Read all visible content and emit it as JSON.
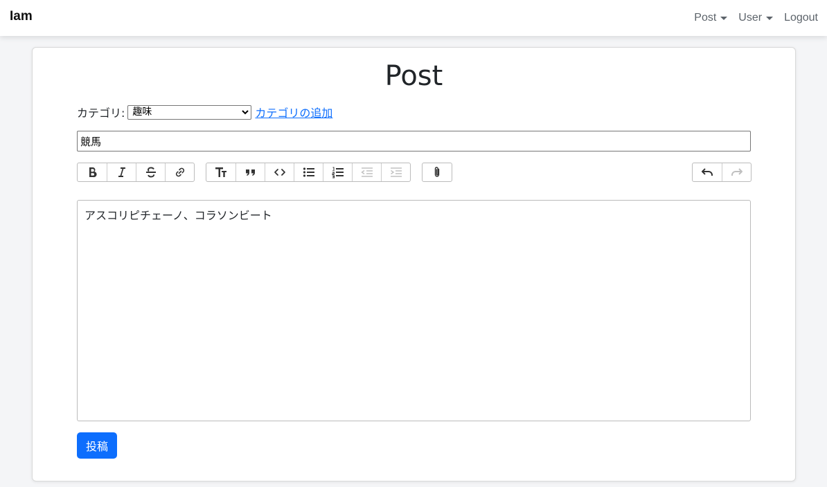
{
  "navbar": {
    "brand": "Iam",
    "items": [
      {
        "label": "Post",
        "dropdown": true
      },
      {
        "label": "User",
        "dropdown": true
      },
      {
        "label": "Logout",
        "dropdown": false
      }
    ]
  },
  "form": {
    "title": "Post",
    "category_label": "カテゴリ:",
    "category_selected": "趣味",
    "add_category_link": "カテゴリの追加",
    "title_value": "競馬",
    "body_text": "アスコリピチェーノ、コラソンビート",
    "submit_label": "投稿"
  },
  "toolbar": {
    "text_tools": [
      "bold-icon",
      "italic-icon",
      "strikethrough-icon",
      "link-icon"
    ],
    "block_tools": [
      "heading-icon",
      "quote-icon",
      "code-icon",
      "bullet-list-icon",
      "numbered-list-icon",
      "decrease-indent-icon",
      "increase-indent-icon"
    ],
    "file_tools": [
      "attach-icon"
    ],
    "history_tools": [
      "undo-icon",
      "redo-icon"
    ]
  },
  "colors": {
    "primary": "#0d6efd",
    "link": "#0d6efd",
    "background": "#f4f5f7"
  }
}
